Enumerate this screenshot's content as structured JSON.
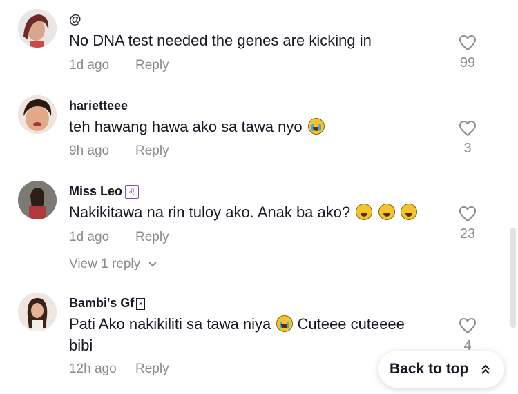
{
  "comments": [
    {
      "username": "@",
      "text": "No DNA test needed the genes are kicking in",
      "time": "1d ago",
      "reply_label": "Reply",
      "likes": "99"
    },
    {
      "username": "harietteee",
      "text": "teh hawang hawa ako sa tawa nyo",
      "time": "9h ago",
      "reply_label": "Reply",
      "likes": "3"
    },
    {
      "username": "Miss Leo",
      "username_badge": "♌",
      "text": "Nakikitawa na rin tuloy ako. Anak ba ako?",
      "time": "1d ago",
      "reply_label": "Reply",
      "likes": "23",
      "view_replies": "View 1 reply"
    },
    {
      "username": "Bambi's Gf",
      "text_part1": "Pati Ako nakikiliti sa tawa niya",
      "text_part2": "Cuteee cuteeee bibi",
      "time": "12h ago",
      "reply_label": "Reply",
      "likes": "4"
    }
  ],
  "back_to_top": "Back to top",
  "icons": {
    "like": "heart-outline-icon",
    "view_replies": "chevron-down-icon",
    "back_to_top": "double-chevron-up-icon"
  },
  "colors": {
    "text": "#161823",
    "muted": "#8a8b91",
    "badge": "#7b4fbf"
  }
}
